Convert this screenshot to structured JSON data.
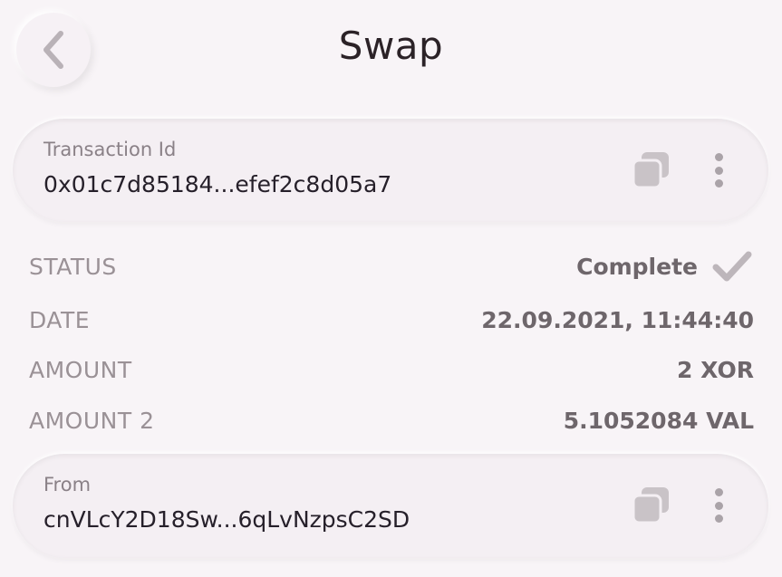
{
  "header": {
    "title": "Swap",
    "back_icon": "chevron-left-icon"
  },
  "transaction": {
    "label": "Transaction Id",
    "value": "0x01c7d85184...efef2c8d05a7",
    "copy_icon": "copy-icon",
    "more_icon": "more-vertical-icon"
  },
  "details": [
    {
      "label": "STATUS",
      "value": "Complete",
      "icon": "check-icon"
    },
    {
      "label": "DATE",
      "value": "22.09.2021, 11:44:40"
    },
    {
      "label": "AMOUNT",
      "value": "2 XOR"
    },
    {
      "label": "AMOUNT 2",
      "value": "5.1052084 VAL"
    }
  ],
  "from": {
    "label": "From",
    "value": "cnVLcY2D18Sw...6qLvNzpsC2SD",
    "copy_icon": "copy-icon",
    "more_icon": "more-vertical-icon"
  },
  "colors": {
    "background": "#f8f4f7",
    "icon_gray": "#c7c1c5",
    "status_check": "#bdb6bb"
  }
}
